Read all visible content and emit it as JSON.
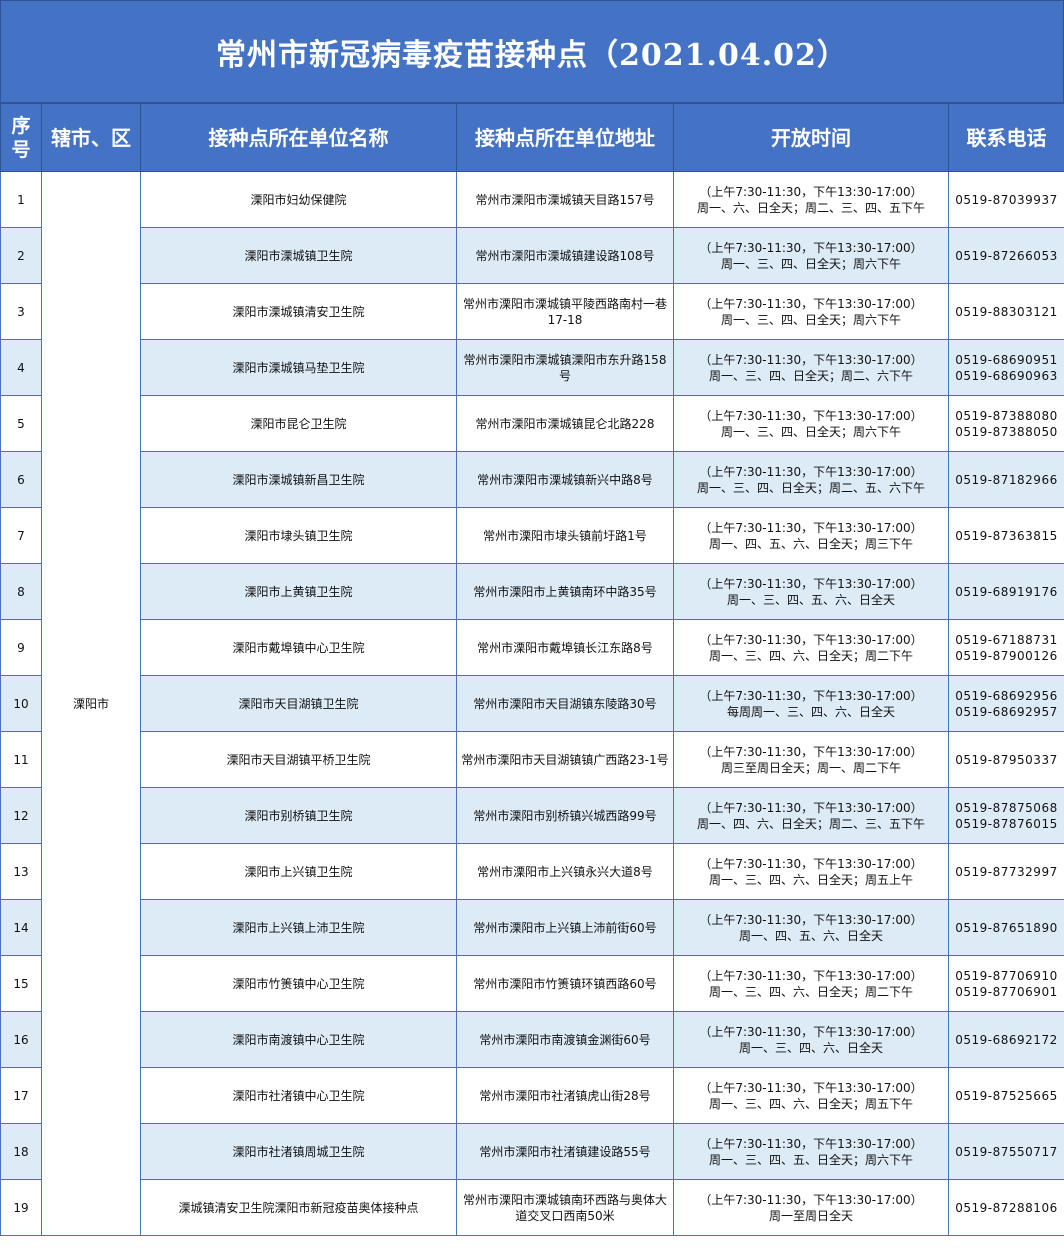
{
  "title": "常州市新冠病毒疫苗接种点（2021.04.02）",
  "headers": {
    "no": "序号",
    "district": "辖市、区",
    "name": "接种点所在单位名称",
    "address": "接种点所在单位地址",
    "hours": "开放时间",
    "phone": "联系电话"
  },
  "district": "溧阳市",
  "rows": [
    {
      "no": "1",
      "name": "溧阳市妇幼保健院",
      "address": "常州市溧阳市溧城镇天目路157号",
      "hours1": "（上午7:30-11:30，下午13:30-17:00）",
      "hours2": "周一、六、日全天；周二、三、四、五下午",
      "phone": "0519-87039937"
    },
    {
      "no": "2",
      "name": "溧阳市溧城镇卫生院",
      "address": "常州市溧阳市溧城镇建设路108号",
      "hours1": "（上午7:30-11:30，下午13:30-17:00）",
      "hours2": "周一、三、四、日全天；周六下午",
      "phone": "0519-87266053"
    },
    {
      "no": "3",
      "name": "溧阳市溧城镇清安卫生院",
      "address": "常州市溧阳市溧城镇平陵西路南村一巷17-18",
      "hours1": "（上午7:30-11:30，下午13:30-17:00）",
      "hours2": "周一、三、四、日全天；周六下午",
      "phone": "0519-88303121"
    },
    {
      "no": "4",
      "name": "溧阳市溧城镇马垫卫生院",
      "address": "常州市溧阳市溧城镇溧阳市东升路158号",
      "hours1": "（上午7:30-11:30，下午13:30-17:00）",
      "hours2": "周一、三、四、日全天；周二、六下午",
      "phone": "0519-68690951",
      "phone2": "0519-68690963"
    },
    {
      "no": "5",
      "name": "溧阳市昆仑卫生院",
      "address": "常州市溧阳市溧城镇昆仑北路228",
      "hours1": "（上午7:30-11:30，下午13:30-17:00）",
      "hours2": "周一、三、四、日全天；周六下午",
      "phone": "0519-87388080",
      "phone2": "0519-87388050"
    },
    {
      "no": "6",
      "name": "溧阳市溧城镇新昌卫生院",
      "address": "常州市溧阳市溧城镇新兴中路8号",
      "hours1": "（上午7:30-11:30，下午13:30-17:00）",
      "hours2": "周一、三、四、日全天；周二、五、六下午",
      "phone": "0519-87182966"
    },
    {
      "no": "7",
      "name": "溧阳市埭头镇卫生院",
      "address": "常州市溧阳市埭头镇前圩路1号",
      "hours1": "（上午7:30-11:30，下午13:30-17:00）",
      "hours2": "周一、四、五、六、日全天；周三下午",
      "phone": "0519-87363815"
    },
    {
      "no": "8",
      "name": "溧阳市上黄镇卫生院",
      "address": "常州市溧阳市上黄镇南环中路35号",
      "hours1": "（上午7:30-11:30，下午13:30-17:00）",
      "hours2": "周一、三、四、五、六、日全天",
      "phone": "0519-68919176"
    },
    {
      "no": "9",
      "name": "溧阳市戴埠镇中心卫生院",
      "address": "常州市溧阳市戴埠镇长江东路8号",
      "hours1": "（上午7:30-11:30，下午13:30-17:00）",
      "hours2": "周一、三、四、六、日全天；周二下午",
      "phone": "0519-67188731",
      "phone2": "0519-87900126"
    },
    {
      "no": "10",
      "name": "溧阳市天目湖镇卫生院",
      "address": "常州市溧阳市天目湖镇东陵路30号",
      "hours1": "（上午7:30-11:30，下午13:30-17:00）",
      "hours2": "每周周一、三、四、六、日全天",
      "phone": "0519-68692956",
      "phone2": "0519-68692957"
    },
    {
      "no": "11",
      "name": "溧阳市天目湖镇平桥卫生院",
      "address": "常州市溧阳市天目湖镇镇广西路23-1号",
      "hours1": "（上午7:30-11:30，下午13:30-17:00）",
      "hours2": "周三至周日全天；周一、周二下午",
      "phone": "0519-87950337"
    },
    {
      "no": "12",
      "name": "溧阳市别桥镇卫生院",
      "address": "常州市溧阳市别桥镇兴城西路99号",
      "hours1": "（上午7:30-11:30，下午13:30-17:00）",
      "hours2": "周一、四、六、日全天；周二、三、五下午",
      "phone": "0519-87875068",
      "phone2": "0519-87876015"
    },
    {
      "no": "13",
      "name": "溧阳市上兴镇卫生院",
      "address": "常州市溧阳市上兴镇永兴大道8号",
      "hours1": "（上午7:30-11:30，下午13:30-17:00）",
      "hours2": "周一、三、四、六、日全天；周五上午",
      "phone": "0519-87732997"
    },
    {
      "no": "14",
      "name": "溧阳市上兴镇上沛卫生院",
      "address": "常州市溧阳市上兴镇上沛前街60号",
      "hours1": "（上午7:30-11:30，下午13:30-17:00）",
      "hours2": "周一、四、五、六、日全天",
      "phone": "0519-87651890"
    },
    {
      "no": "15",
      "name": "溧阳市竹箦镇中心卫生院",
      "address": "常州市溧阳市竹箦镇环镇西路60号",
      "hours1": "（上午7:30-11:30，下午13:30-17:00）",
      "hours2": "周一、三、四、六、日全天；周二下午",
      "phone": "0519-87706910",
      "phone2": "0519-87706901"
    },
    {
      "no": "16",
      "name": "溧阳市南渡镇中心卫生院",
      "address": "常州市溧阳市南渡镇金渊街60号",
      "hours1": "（上午7:30-11:30，下午13:30-17:00）",
      "hours2": "周一、三、四、六、日全天",
      "phone": "0519-68692172"
    },
    {
      "no": "17",
      "name": "溧阳市社渚镇中心卫生院",
      "address": "常州市溧阳市社渚镇虎山街28号",
      "hours1": "（上午7:30-11:30，下午13:30-17:00）",
      "hours2": "周一、三、四、六、日全天；周五下午",
      "phone": "0519-87525665"
    },
    {
      "no": "18",
      "name": "溧阳市社渚镇周城卫生院",
      "address": "常州市溧阳市社渚镇建设路55号",
      "hours1": "（上午7:30-11:30，下午13:30-17:00）",
      "hours2": "周一、三、四、五、日全天；周六下午",
      "phone": "0519-87550717"
    },
    {
      "no": "19",
      "name": "溧城镇清安卫生院溧阳市新冠疫苗奥体接种点",
      "address": "常州市溧阳市溧城镇南环西路与奥体大道交叉口西南50米",
      "hours1": "（上午7:30-11:30，下午13:30-17:00）",
      "hours2": "周一至周日全天",
      "phone": "0519-87288106"
    }
  ]
}
